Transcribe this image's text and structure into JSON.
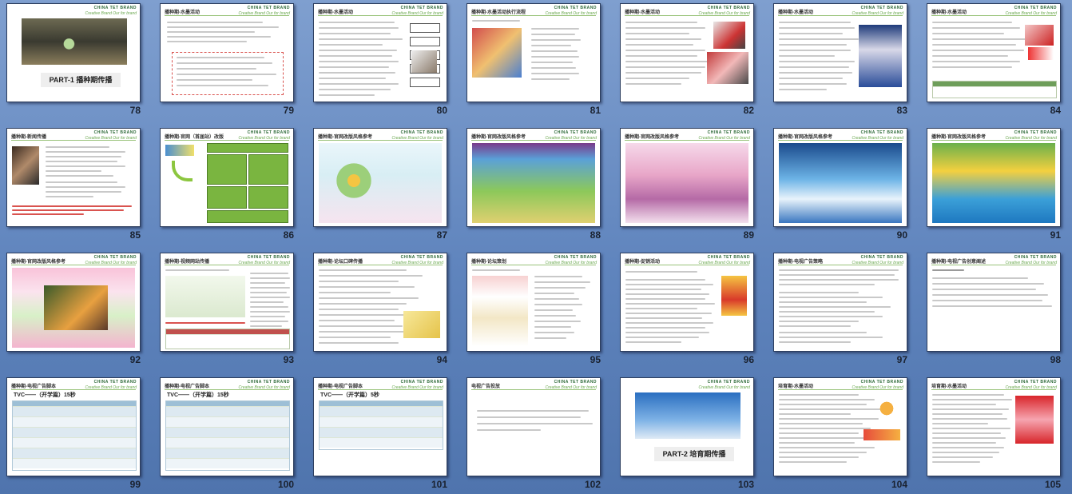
{
  "brand": {
    "en": "CHINA TET BRAND",
    "sub": "Creative Brand  Our for brand"
  },
  "slides": [
    {
      "num": "78",
      "title": "",
      "kind": "cover",
      "part": "PART-1   播种期传播"
    },
    {
      "num": "79",
      "title": "播种期-水墨活动",
      "kind": "text"
    },
    {
      "num": "80",
      "title": "播种期-水墨活动",
      "kind": "flow"
    },
    {
      "num": "81",
      "title": "播种期-水墨活动执行流程",
      "kind": "photo"
    },
    {
      "num": "82",
      "title": "播种期-水墨活动",
      "kind": "photo2"
    },
    {
      "num": "83",
      "title": "播种期-水墨活动",
      "kind": "record"
    },
    {
      "num": "84",
      "title": "播种期-水墨活动",
      "kind": "table"
    },
    {
      "num": "85",
      "title": "播种期-新闻传播",
      "kind": "news"
    },
    {
      "num": "86",
      "title": "播种期-官网（首届站）改版",
      "kind": "green"
    },
    {
      "num": "87",
      "title": "播种期-官网改版风格参考",
      "kind": "web1"
    },
    {
      "num": "88",
      "title": "播种期-官网改版风格参考",
      "kind": "web2"
    },
    {
      "num": "89",
      "title": "播种期-官网改版风格参考",
      "kind": "web3"
    },
    {
      "num": "90",
      "title": "播种期-官网改版风格参考",
      "kind": "web4"
    },
    {
      "num": "91",
      "title": "播种期-官网改版风格参考",
      "kind": "web5"
    },
    {
      "num": "92",
      "title": "播种期-官网改版风格参考",
      "kind": "web6"
    },
    {
      "num": "93",
      "title": "播种期-视频网站传播",
      "kind": "video"
    },
    {
      "num": "94",
      "title": "播种期-论坛口碑传播",
      "kind": "forum"
    },
    {
      "num": "95",
      "title": "播种期-论坛策划",
      "kind": "forum2"
    },
    {
      "num": "96",
      "title": "播种期-促销活动",
      "kind": "promo"
    },
    {
      "num": "97",
      "title": "播种期-电视广告策略",
      "kind": "text2"
    },
    {
      "num": "98",
      "title": "播种期-电视广告创意阐述",
      "kind": "tv"
    },
    {
      "num": "99",
      "title": "播种期-电视广告脚本",
      "kind": "script",
      "tv": "TVC——（开学篇）15秒"
    },
    {
      "num": "100",
      "title": "播种期-电视广告脚本",
      "kind": "script",
      "tv": "TVC——（开学篇）15秒"
    },
    {
      "num": "101",
      "title": "播种期-电视广告脚本",
      "kind": "script2",
      "tv": "TVC——（开学篇）5秒"
    },
    {
      "num": "102",
      "title": "电视广告投放",
      "kind": "text3"
    },
    {
      "num": "103",
      "title": "",
      "kind": "cover2",
      "part": "PART-2   培育期传播"
    },
    {
      "num": "104",
      "title": "培育期-水墨活动",
      "kind": "promo2"
    },
    {
      "num": "105",
      "title": "培育期-水墨活动",
      "kind": "kid"
    }
  ]
}
